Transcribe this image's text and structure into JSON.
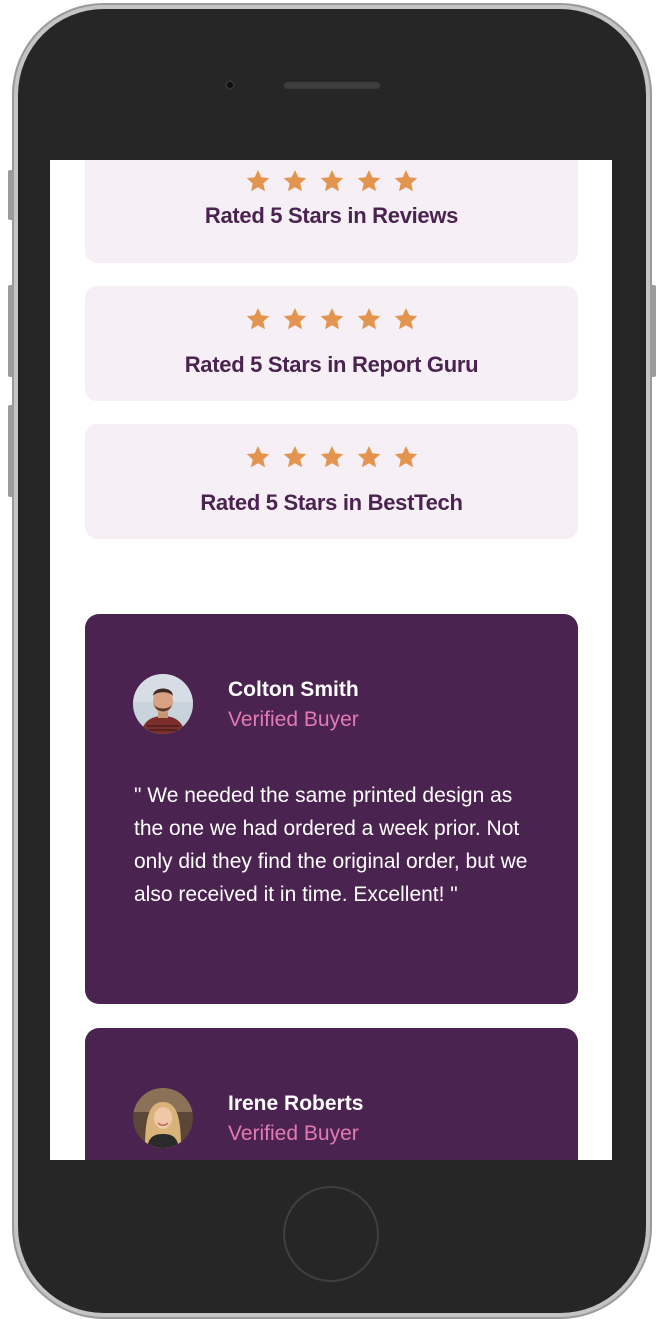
{
  "ratings": [
    {
      "label": "Rated 5 Stars in Reviews",
      "stars": 5
    },
    {
      "label": "Rated 5 Stars in Report Guru",
      "stars": 5
    },
    {
      "label": "Rated 5 Stars in BestTech",
      "stars": 5
    }
  ],
  "testimonials": [
    {
      "name": "Colton Smith",
      "badge": "Verified Buyer",
      "quote": "\" We needed the same printed design as the one we had ordered a week prior. Not only did they find the original order, but we also received it in time. Excellent! \""
    },
    {
      "name": "Irene Roberts",
      "badge": "Verified Buyer",
      "quote": ""
    }
  ],
  "colors": {
    "star": "#e39550",
    "card_bg": "#f6f0f6",
    "brand_purple": "#4b2350",
    "accent_pink": "#e27bb1"
  }
}
